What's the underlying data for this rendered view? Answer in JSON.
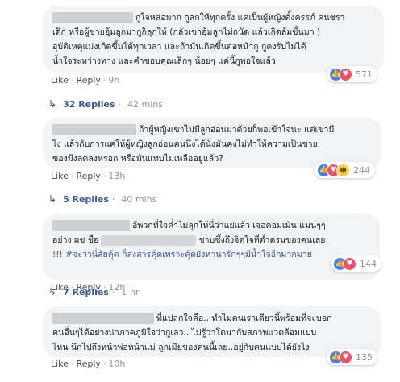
{
  "colors": {
    "bubble_bg": "#f2f3f5",
    "link_blue": "#385898",
    "muted": "#90949c",
    "like_blue": "#4080ff",
    "love_red": "#f25268",
    "haha_yellow": "#f7c94b"
  },
  "comments": [
    {
      "lines": [
        "กูใจหล่อมาก กูลกให้ทุกครั้ง แค่เป็นผู้หญิงตั้งครรภ์ คนชรา",
        "เด็ก หรือผู้ชายอุ้มลูกมากูก็ลุกให้ (กลัวเขาอุ้มลูกไม่ถนัด แล้วเกิดล้มขึ้นมา )",
        "อุบัติเหตุแม่งเกิดขึ้นได้ทุกเวลา และถ้ามันเกิดขึ้นต่อหน้ากู กูคงรับไม่ได้",
        "น้ำใจระหว่างทาง และคำขอบคุณเล็กๆ น้อยๆ แค่นี้กูพอใจแล้ว"
      ],
      "like": "Like",
      "reply": "Reply",
      "time": "9h",
      "reactions": [
        "like",
        "love"
      ],
      "reaction_count": "571",
      "replies_label": "32 Replies",
      "replies_time": "42 mins"
    },
    {
      "lines": [
        "ถ้าผู้หญิงเขาไม่มีลูกอ่อนมาด้วยก็พอเข้าใจนะ แต่เขามี",
        "ไง แล้วกับการแค่ให้ผู้หญิงลูกอ่อนคนนึงได้นั่งมันคงไม่ทำให้ความเป็นชาย",
        "ของมึงลดลงหรอก หรือมันแทบไม่เหลืออยู่แล้ว?"
      ],
      "like": "Like",
      "reply": "Reply",
      "time": "13h",
      "reactions": [
        "like",
        "love",
        "haha"
      ],
      "reaction_count": "244",
      "replies_label": "5 Replies",
      "replies_time": "40 mins"
    },
    {
      "lines": [
        "อีพวกที่ใจค่ำไม่ลุกให้นี่ว่าแย่แล้ว เจอคอมเม้น แมนๆๆ",
        "อย่าง ผช ชื่อ",
        "ชาบซึ้งถึงจิตใจที่ต่ำตรมของคนเลย",
        "!!! #จะว่านี่สัยคุ้ด ก็สงสารคุ้ดเพราะคุ้ดยังหาน่ารักๆๆมีน้ำใจอีกมากมาย"
      ],
      "like": "Like",
      "reply": "Reply",
      "time": "12h",
      "reactions": [
        "like",
        "love"
      ],
      "reaction_count": "144",
      "replies_label": "7 Replies",
      "replies_time": "1 hr"
    },
    {
      "lines": [
        "ที่แปลกใจคือ.. ทำไมคนเราเดียวนี้พร้อมที่จะบอก",
        "คนอื่นๆได้อย่างน่าภาคภูมิใจว่ากูเลว.. ไม่รู้ว่าโตมากับสภาพแวดล้อมแบบ",
        "ไหน นึกไปถึงหน้าพ่อหน้าแม่ ลูกเมียของคนนี้เลย..อยู่กับคนแบบได้ยังไง"
      ],
      "like": "Like",
      "reply": "Reply",
      "time": "10h",
      "reactions": [
        "like",
        "love"
      ],
      "reaction_count": "135"
    }
  ]
}
